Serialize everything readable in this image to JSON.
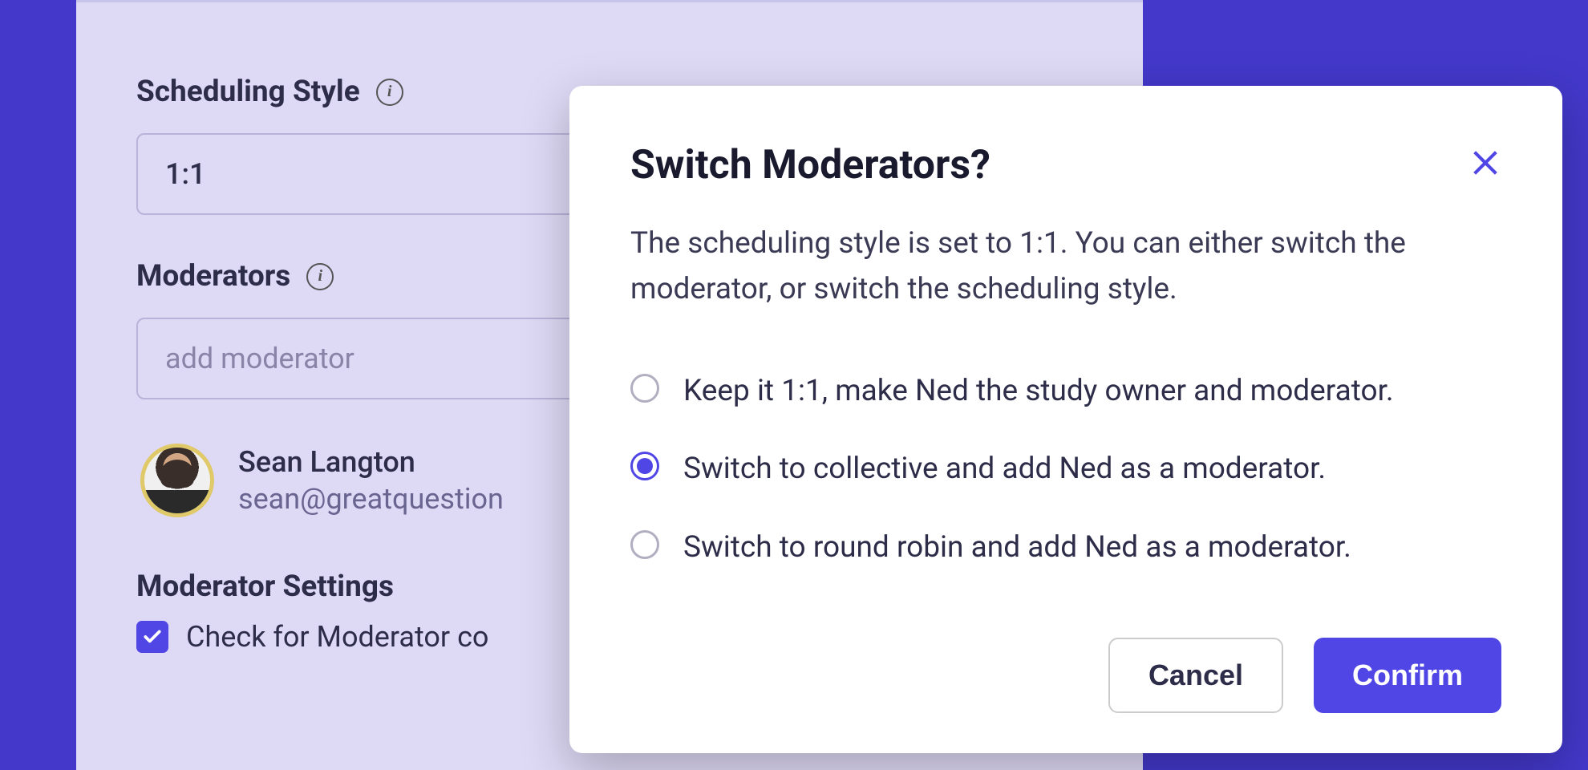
{
  "panel": {
    "schedulingStyleLabel": "Scheduling Style",
    "schedulingStyleValue": "1:1",
    "moderatorsLabel": "Moderators",
    "addModeratorPlaceholder": "add moderator",
    "moderator": {
      "name": "Sean Langton",
      "email": "sean@greatquestion"
    },
    "moderatorSettingsLabel": "Moderator Settings",
    "conflictCheckboxLabel": "Check for Moderator co"
  },
  "modal": {
    "title": "Switch Moderators?",
    "description": "The scheduling style is set to 1:1. You can either switch the moderator, or switch the scheduling style.",
    "options": [
      "Keep it 1:1, make Ned the study owner and moderator.",
      "Switch to collective and add Ned as a moderator.",
      "Switch to round robin and add Ned as a moderator."
    ],
    "selectedIndex": 1,
    "cancelLabel": "Cancel",
    "confirmLabel": "Confirm"
  }
}
